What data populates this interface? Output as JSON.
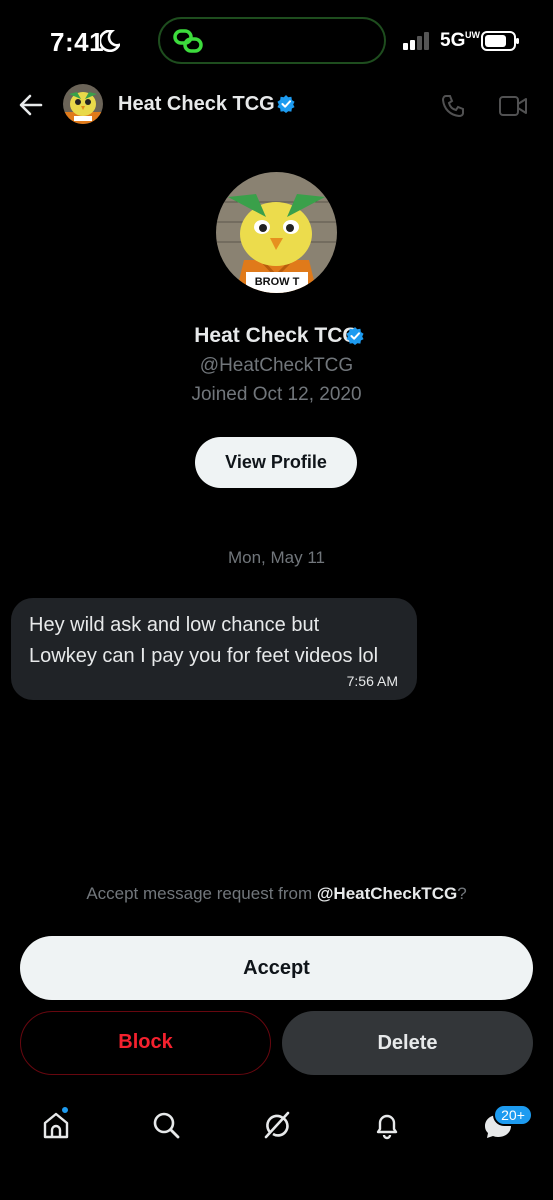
{
  "status_bar": {
    "time": "7:41",
    "network": "5G",
    "network_sup": "UW"
  },
  "header": {
    "name": "Heat Check TCG",
    "icons": [
      "back-arrow-icon",
      "phone-icon",
      "video-icon",
      "verified-badge-icon"
    ]
  },
  "profile": {
    "name": "Heat Check TCG",
    "handle": "@HeatCheckTCG",
    "joined": "Joined Oct 12, 2020",
    "view_profile_label": "View Profile",
    "avatar_sign_text": "BROW T"
  },
  "conversation": {
    "date_separator": "Mon, May 11",
    "messages": [
      {
        "line1": "Hey wild ask and low chance but",
        "line2": "Lowkey can I pay you for feet videos lol",
        "time": "7:56 AM"
      }
    ]
  },
  "request": {
    "prefix": "Accept message request from ",
    "handle": "@HeatCheckTCG",
    "suffix": "?",
    "accept_label": "Accept",
    "block_label": "Block",
    "delete_label": "Delete"
  },
  "tab_bar": {
    "icons": [
      "home-icon",
      "search-icon",
      "grok-icon",
      "notifications-icon",
      "messages-icon"
    ],
    "messages_badge": "20+"
  },
  "colors": {
    "accent": "#1d9bf0",
    "danger": "#f4212e",
    "background": "#000000"
  }
}
